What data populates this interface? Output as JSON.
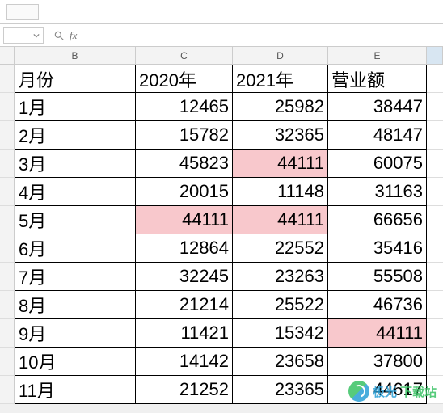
{
  "formula_bar": {
    "fx_label": "fx"
  },
  "columns": [
    "B",
    "C",
    "D",
    "E"
  ],
  "headers": {
    "B": "月份",
    "C": "2020年",
    "D": "2021年",
    "E": "营业额"
  },
  "rows": [
    {
      "B": "1月",
      "C": "12465",
      "D": "25982",
      "E": "38447"
    },
    {
      "B": "2月",
      "C": "15782",
      "D": "32365",
      "E": "48147"
    },
    {
      "B": "3月",
      "C": "45823",
      "D": "44111",
      "E": "60075",
      "hl": [
        "D"
      ]
    },
    {
      "B": "4月",
      "C": "20015",
      "D": "11148",
      "E": "31163"
    },
    {
      "B": "5月",
      "C": "44111",
      "D": "44111",
      "E": "66656",
      "hl": [
        "C",
        "D"
      ]
    },
    {
      "B": "6月",
      "C": "12864",
      "D": "22552",
      "E": "35416"
    },
    {
      "B": "7月",
      "C": "32245",
      "D": "23263",
      "E": "55508"
    },
    {
      "B": "8月",
      "C": "21214",
      "D": "25522",
      "E": "46736"
    },
    {
      "B": "9月",
      "C": "11421",
      "D": "15342",
      "E": "44111",
      "hl": [
        "E"
      ]
    },
    {
      "B": "10月",
      "C": "14142",
      "D": "23658",
      "E": "37800"
    },
    {
      "B": "11月",
      "C": "21252",
      "D": "23365",
      "E": "44617"
    }
  ],
  "watermark": {
    "text1": "极光",
    "text2": "下载站"
  },
  "chart_data": {
    "type": "table",
    "title": "",
    "columns": [
      "月份",
      "2020年",
      "2021年",
      "营业额"
    ],
    "rows": [
      [
        "1月",
        12465,
        25982,
        38447
      ],
      [
        "2月",
        15782,
        32365,
        48147
      ],
      [
        "3月",
        45823,
        44111,
        60075
      ],
      [
        "4月",
        20015,
        11148,
        31163
      ],
      [
        "5月",
        44111,
        44111,
        66656
      ],
      [
        "6月",
        12864,
        22552,
        35416
      ],
      [
        "7月",
        32245,
        23263,
        55508
      ],
      [
        "8月",
        21214,
        25522,
        46736
      ],
      [
        "9月",
        11421,
        15342,
        44111
      ],
      [
        "10月",
        14142,
        23658,
        37800
      ],
      [
        "11月",
        21252,
        23365,
        44617
      ]
    ],
    "highlighted_value": 44111
  }
}
